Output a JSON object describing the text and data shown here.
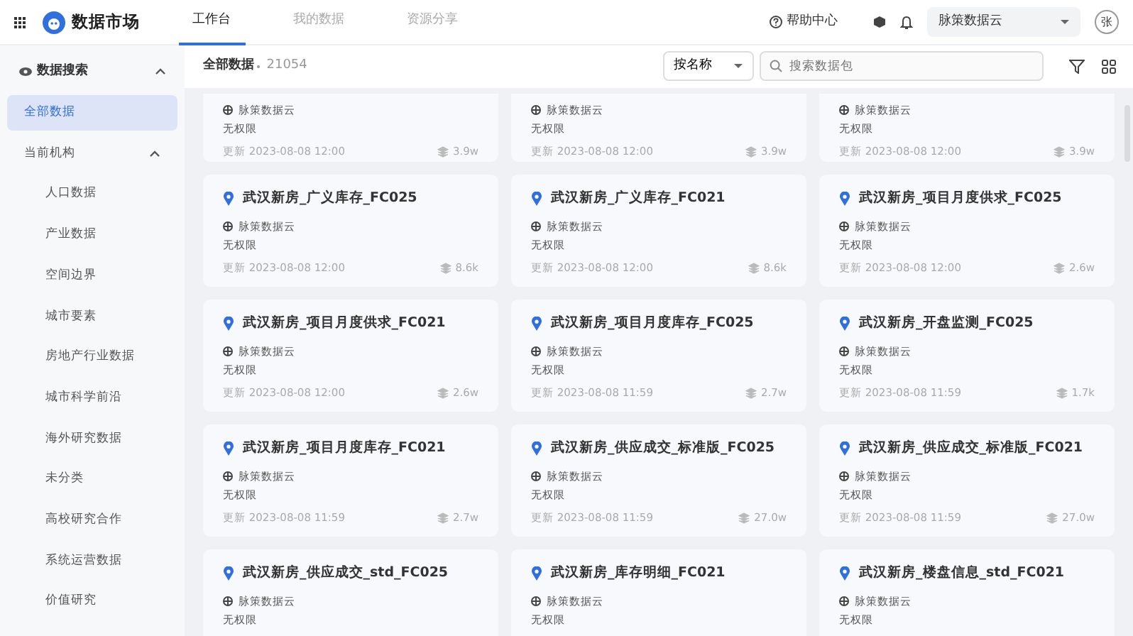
{
  "header": {
    "app_title": "数据市场",
    "tabs": [
      {
        "label": "工作台",
        "selected": true
      },
      {
        "label": "我的数据",
        "selected": false
      },
      {
        "label": "资源分享",
        "selected": false
      }
    ],
    "help": "帮助中心",
    "org_select": "脉策数据云",
    "avatar": "张"
  },
  "sidebar": {
    "section": {
      "label": "数据搜索",
      "expanded": true
    },
    "items": [
      {
        "label": "全部数据",
        "selected": true
      },
      {
        "label": "当前机构",
        "selected": false,
        "expanded": true,
        "children": [
          {
            "label": "人口数据",
            "selected": false
          },
          {
            "label": "产业数据",
            "selected": false
          },
          {
            "label": "空间边界",
            "selected": false
          },
          {
            "label": "城市要素",
            "selected": false
          },
          {
            "label": "房地产行业数据",
            "selected": false
          },
          {
            "label": "城市科学前沿",
            "selected": false
          },
          {
            "label": "海外研究数据",
            "selected": false
          },
          {
            "label": "未分类",
            "selected": false
          },
          {
            "label": "高校研究合作",
            "selected": false
          },
          {
            "label": "系统运营数据",
            "selected": false
          },
          {
            "label": "价值研究",
            "selected": false
          }
        ]
      }
    ]
  },
  "toolbar": {
    "title": "全部数据",
    "count": "21054",
    "sort": "按名称",
    "search": {
      "placeholder": "搜索数据包"
    }
  },
  "cards": [
    {
      "org": "脉策数据云",
      "permission": "无权限",
      "updated": "更新 2023-08-08 12:00",
      "size": "3.9w"
    },
    {
      "org": "脉策数据云",
      "permission": "无权限",
      "updated": "更新 2023-08-08 12:00",
      "size": "3.9w"
    },
    {
      "org": "脉策数据云",
      "permission": "无权限",
      "updated": "更新 2023-08-08 12:00",
      "size": "3.9w"
    },
    {
      "title": "武汉新房_广义库存_FC025",
      "org": "脉策数据云",
      "permission": "无权限",
      "updated": "更新 2023-08-08 12:00",
      "size": "8.6k"
    },
    {
      "title": "武汉新房_广义库存_FC021",
      "org": "脉策数据云",
      "permission": "无权限",
      "updated": "更新 2023-08-08 12:00",
      "size": "8.6k"
    },
    {
      "title": "武汉新房_项目月度供求_FC025",
      "org": "脉策数据云",
      "permission": "无权限",
      "updated": "更新 2023-08-08 12:00",
      "size": "2.6w"
    },
    {
      "title": "武汉新房_项目月度供求_FC021",
      "org": "脉策数据云",
      "permission": "无权限",
      "updated": "更新 2023-08-08 12:00",
      "size": "2.6w"
    },
    {
      "title": "武汉新房_项目月度库存_FC025",
      "org": "脉策数据云",
      "permission": "无权限",
      "updated": "更新 2023-08-08 11:59",
      "size": "2.7w"
    },
    {
      "title": "武汉新房_开盘监测_FC025",
      "org": "脉策数据云",
      "permission": "无权限",
      "updated": "更新 2023-08-08 11:59",
      "size": "1.7k"
    },
    {
      "title": "武汉新房_项目月度库存_FC021",
      "org": "脉策数据云",
      "permission": "无权限",
      "updated": "更新 2023-08-08 11:59",
      "size": "2.7w"
    },
    {
      "title": "武汉新房_供应成交_标准版_FC025",
      "org": "脉策数据云",
      "permission": "无权限",
      "updated": "更新 2023-08-08 11:59",
      "size": "27.0w"
    },
    {
      "title": "武汉新房_供应成交_标准版_FC021",
      "org": "脉策数据云",
      "permission": "无权限",
      "updated": "更新 2023-08-08 11:59",
      "size": "27.0w"
    },
    {
      "title": "武汉新房_供应成交_std_FC025",
      "org": "脉策数据云",
      "permission": "无权限"
    },
    {
      "title": "武汉新房_库存明细_FC021",
      "org": "脉策数据云",
      "permission": "无权限"
    },
    {
      "title": "武汉新房_楼盘信息_std_FC021",
      "org": "脉策数据云",
      "permission": "无权限"
    }
  ]
}
